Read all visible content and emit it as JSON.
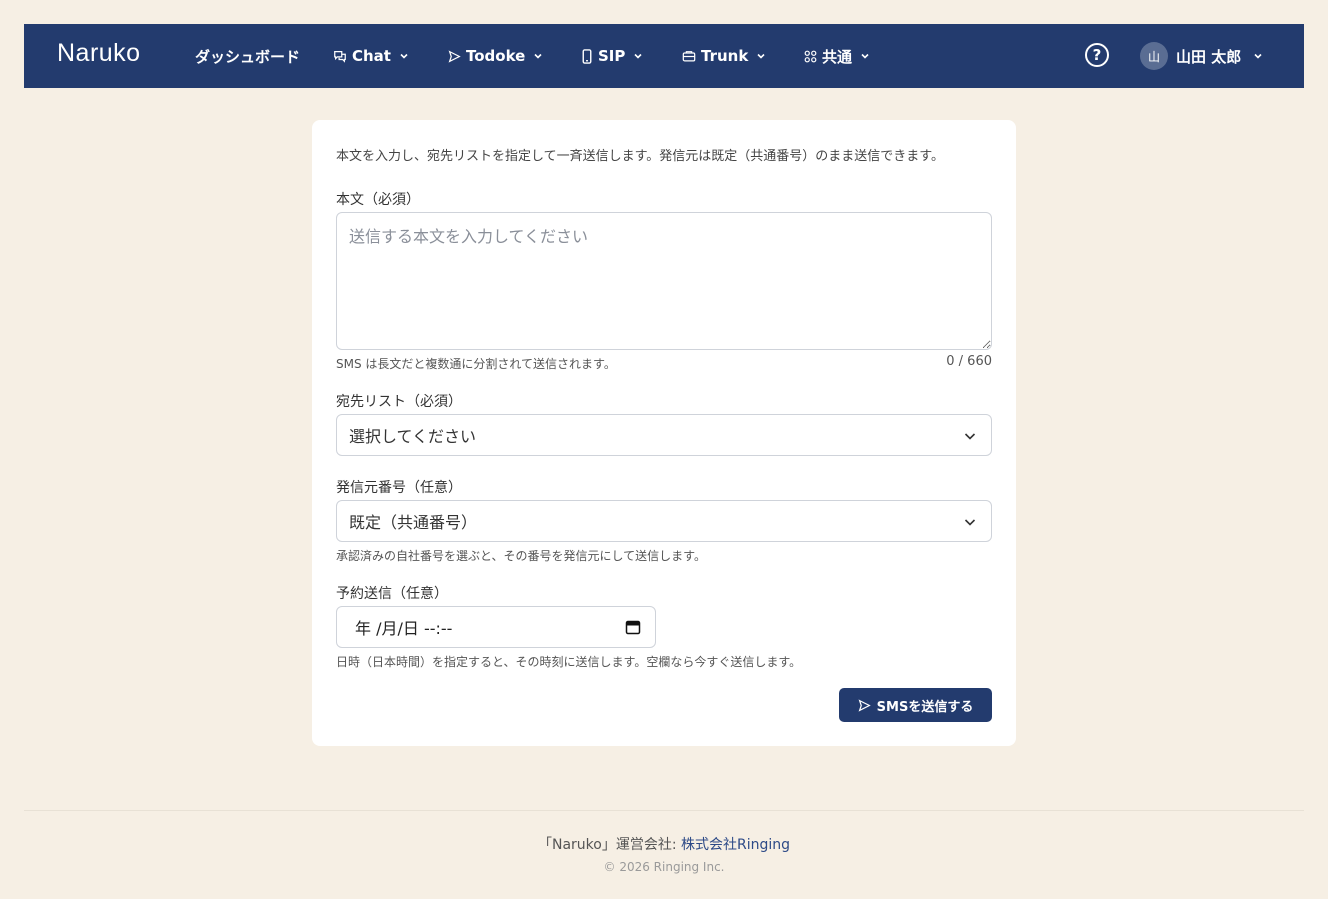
{
  "nav": {
    "brand": "Naruko",
    "dashboard": "ダッシュボード",
    "chat": "Chat",
    "todoke": "Todoke",
    "sip": "SIP",
    "trunk": "Trunk",
    "common": "共通",
    "help": "?",
    "user_initial": "山",
    "user_name": "山田 太郎"
  },
  "form": {
    "intro": "本文を入力し、宛先リストを指定して一斉送信します。発信元は既定（共通番号）のまま送信できます。",
    "body_label": "本文（必須）",
    "body_placeholder": "送信する本文を入力してください",
    "body_value": "",
    "body_hint": "SMS は長文だと複数通に分割されて送信されます。",
    "counter": "0 / 660",
    "recipients_label": "宛先リスト（必須）",
    "recipients_value": "選択してください",
    "sender_label": "発信元番号（任意）",
    "sender_value": "既定（共通番号）",
    "sender_hint": "承認済みの自社番号を選ぶと、その番号を発信元にして送信します。",
    "schedule_label": "予約送信（任意）",
    "schedule_value": "年 /月/日 --:--",
    "schedule_hint": "日時（日本時間）を指定すると、その時刻に送信します。空欄なら今すぐ送信します。",
    "submit_label": "SMSを送信する"
  },
  "footer": {
    "prefix": "「Naruko」運営会社: ",
    "company_link": "株式会社Ringing",
    "copyright": "© 2026 Ringing Inc."
  }
}
